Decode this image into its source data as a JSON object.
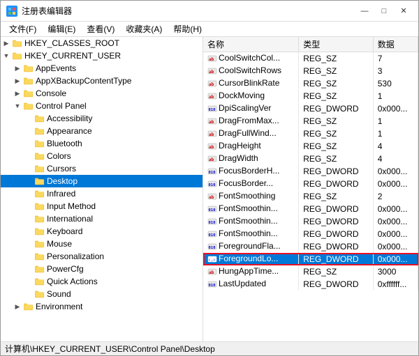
{
  "window": {
    "title": "注册表编辑器",
    "icon": "reg"
  },
  "titlebar": {
    "minimize": "—",
    "maximize": "□",
    "close": "✕"
  },
  "menu": {
    "items": [
      "文件(F)",
      "编辑(E)",
      "查看(V)",
      "收藏夹(A)",
      "帮助(H)"
    ]
  },
  "tree": {
    "nodes": [
      {
        "id": "classes_root",
        "label": "HKEY_CLASSES_ROOT",
        "indent": 1,
        "expanded": false,
        "selected": false
      },
      {
        "id": "current_user",
        "label": "HKEY_CURRENT_USER",
        "indent": 1,
        "expanded": true,
        "selected": false
      },
      {
        "id": "appevents",
        "label": "AppEvents",
        "indent": 2,
        "expanded": false,
        "selected": false
      },
      {
        "id": "appxbackup",
        "label": "AppXBackupContentType",
        "indent": 2,
        "expanded": false,
        "selected": false
      },
      {
        "id": "console",
        "label": "Console",
        "indent": 2,
        "expanded": false,
        "selected": false
      },
      {
        "id": "control_panel",
        "label": "Control Panel",
        "indent": 2,
        "expanded": true,
        "selected": false
      },
      {
        "id": "accessibility",
        "label": "Accessibility",
        "indent": 3,
        "expanded": false,
        "selected": false
      },
      {
        "id": "appearance",
        "label": "Appearance",
        "indent": 3,
        "expanded": false,
        "selected": false
      },
      {
        "id": "bluetooth",
        "label": "Bluetooth",
        "indent": 3,
        "expanded": false,
        "selected": false
      },
      {
        "id": "colors",
        "label": "Colors",
        "indent": 3,
        "expanded": false,
        "selected": false
      },
      {
        "id": "cursors",
        "label": "Cursors",
        "indent": 3,
        "expanded": false,
        "selected": false
      },
      {
        "id": "desktop",
        "label": "Desktop",
        "indent": 3,
        "expanded": false,
        "selected": true
      },
      {
        "id": "infrared",
        "label": "Infrared",
        "indent": 3,
        "expanded": false,
        "selected": false
      },
      {
        "id": "input_method",
        "label": "Input Method",
        "indent": 3,
        "expanded": false,
        "selected": false
      },
      {
        "id": "international",
        "label": "International",
        "indent": 3,
        "expanded": false,
        "selected": false
      },
      {
        "id": "keyboard",
        "label": "Keyboard",
        "indent": 3,
        "expanded": false,
        "selected": false
      },
      {
        "id": "mouse",
        "label": "Mouse",
        "indent": 3,
        "expanded": false,
        "selected": false
      },
      {
        "id": "personalization",
        "label": "Personalization",
        "indent": 3,
        "expanded": false,
        "selected": false
      },
      {
        "id": "powercfg",
        "label": "PowerCfg",
        "indent": 3,
        "expanded": false,
        "selected": false
      },
      {
        "id": "quick_actions",
        "label": "Quick Actions",
        "indent": 3,
        "expanded": false,
        "selected": false
      },
      {
        "id": "sound",
        "label": "Sound",
        "indent": 3,
        "expanded": false,
        "selected": false
      },
      {
        "id": "environment",
        "label": "Environment",
        "indent": 2,
        "expanded": false,
        "selected": false
      }
    ]
  },
  "columns": {
    "name": "名称",
    "type": "类型",
    "data": "数据"
  },
  "values": [
    {
      "name": "CoolSwitchCol...",
      "type": "REG_SZ",
      "data": "7",
      "selected": false
    },
    {
      "name": "CoolSwitchRows",
      "type": "REG_SZ",
      "data": "3",
      "selected": false
    },
    {
      "name": "CursorBlinkRate",
      "type": "REG_SZ",
      "data": "530",
      "selected": false
    },
    {
      "name": "DockMoving",
      "type": "REG_SZ",
      "data": "1",
      "selected": false
    },
    {
      "name": "DpiScalingVer",
      "type": "REG_DWORD",
      "data": "0x000...",
      "selected": false
    },
    {
      "name": "DragFromMax...",
      "type": "REG_SZ",
      "data": "1",
      "selected": false
    },
    {
      "name": "DragFullWind...",
      "type": "REG_SZ",
      "data": "1",
      "selected": false
    },
    {
      "name": "DragHeight",
      "type": "REG_SZ",
      "data": "4",
      "selected": false
    },
    {
      "name": "DragWidth",
      "type": "REG_SZ",
      "data": "4",
      "selected": false
    },
    {
      "name": "FocusBorderH...",
      "type": "REG_DWORD",
      "data": "0x000...",
      "selected": false
    },
    {
      "name": "FocusBorder...",
      "type": "REG_DWORD",
      "data": "0x000...",
      "selected": false
    },
    {
      "name": "FontSmoothing",
      "type": "REG_SZ",
      "data": "2",
      "selected": false
    },
    {
      "name": "FontSmoothin...",
      "type": "REG_DWORD",
      "data": "0x000...",
      "selected": false
    },
    {
      "name": "FontSmoothin...",
      "type": "REG_DWORD",
      "data": "0x000...",
      "selected": false
    },
    {
      "name": "FontSmoothin...",
      "type": "REG_DWORD",
      "data": "0x000...",
      "selected": false
    },
    {
      "name": "ForegroundFla...",
      "type": "REG_DWORD",
      "data": "0x000...",
      "selected": false
    },
    {
      "name": "ForegroundLo...",
      "type": "REG_DWORD",
      "data": "0x000...",
      "selected": true
    },
    {
      "name": "HungAppTime...",
      "type": "REG_SZ",
      "data": "3000",
      "selected": false
    },
    {
      "name": "LastUpdated",
      "type": "REG_DWORD",
      "data": "0xffffff...",
      "selected": false
    }
  ],
  "statusbar": {
    "text": "计算机\\HKEY_CURRENT_USER\\Control Panel\\Desktop"
  }
}
